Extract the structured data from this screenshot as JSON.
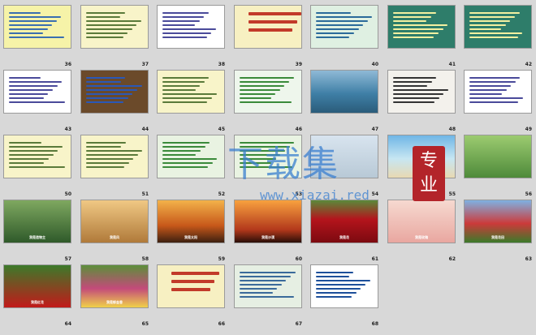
{
  "slides": [
    {
      "number": "36",
      "theme": "text-yellow"
    },
    {
      "number": "37",
      "theme": "text-cream"
    },
    {
      "number": "38",
      "theme": "text-white"
    },
    {
      "number": "39",
      "theme": "title-cream"
    },
    {
      "number": "40",
      "theme": "text-green"
    },
    {
      "number": "41",
      "theme": "text-green-dark"
    },
    {
      "number": "42",
      "theme": "text-green-dark2"
    },
    {
      "number": "43",
      "theme": "text-white"
    },
    {
      "number": "44",
      "theme": "diagram"
    },
    {
      "number": "45",
      "theme": "text-cream"
    },
    {
      "number": "46",
      "theme": "diagram-green"
    },
    {
      "number": "47",
      "theme": "sea"
    },
    {
      "number": "48",
      "theme": "ink"
    },
    {
      "number": "49",
      "theme": "text-white"
    },
    {
      "number": "50",
      "theme": "text-cream"
    },
    {
      "number": "51",
      "theme": "text-cream"
    },
    {
      "number": "52",
      "theme": "table-green"
    },
    {
      "number": "53",
      "theme": "table-green"
    },
    {
      "number": "54",
      "theme": "book"
    },
    {
      "number": "55",
      "theme": "beach"
    },
    {
      "number": "56",
      "theme": "flowers"
    },
    {
      "number": "57",
      "theme": "stream",
      "caption": "我是造物主"
    },
    {
      "number": "58",
      "theme": "dunes",
      "caption": "我是风"
    },
    {
      "number": "59",
      "theme": "sunset",
      "caption": "我是太阳"
    },
    {
      "number": "60",
      "theme": "cactus",
      "caption": "我是沙漠"
    },
    {
      "number": "61",
      "theme": "redfield",
      "caption": "我是花"
    },
    {
      "number": "62",
      "theme": "roses",
      "caption": "我是玫瑰"
    },
    {
      "number": "63",
      "theme": "flowerfield",
      "caption": "我是花田"
    },
    {
      "number": "64",
      "theme": "redflowers",
      "caption": "我是红花"
    },
    {
      "number": "65",
      "theme": "tulips",
      "caption": "我是郁金香"
    },
    {
      "number": "66",
      "theme": "title-cream"
    },
    {
      "number": "67",
      "theme": "figure"
    },
    {
      "number": "68",
      "theme": "brand"
    }
  ],
  "watermark": {
    "title": "下载集",
    "url": "www.xiazai.red",
    "seal": "专业"
  }
}
